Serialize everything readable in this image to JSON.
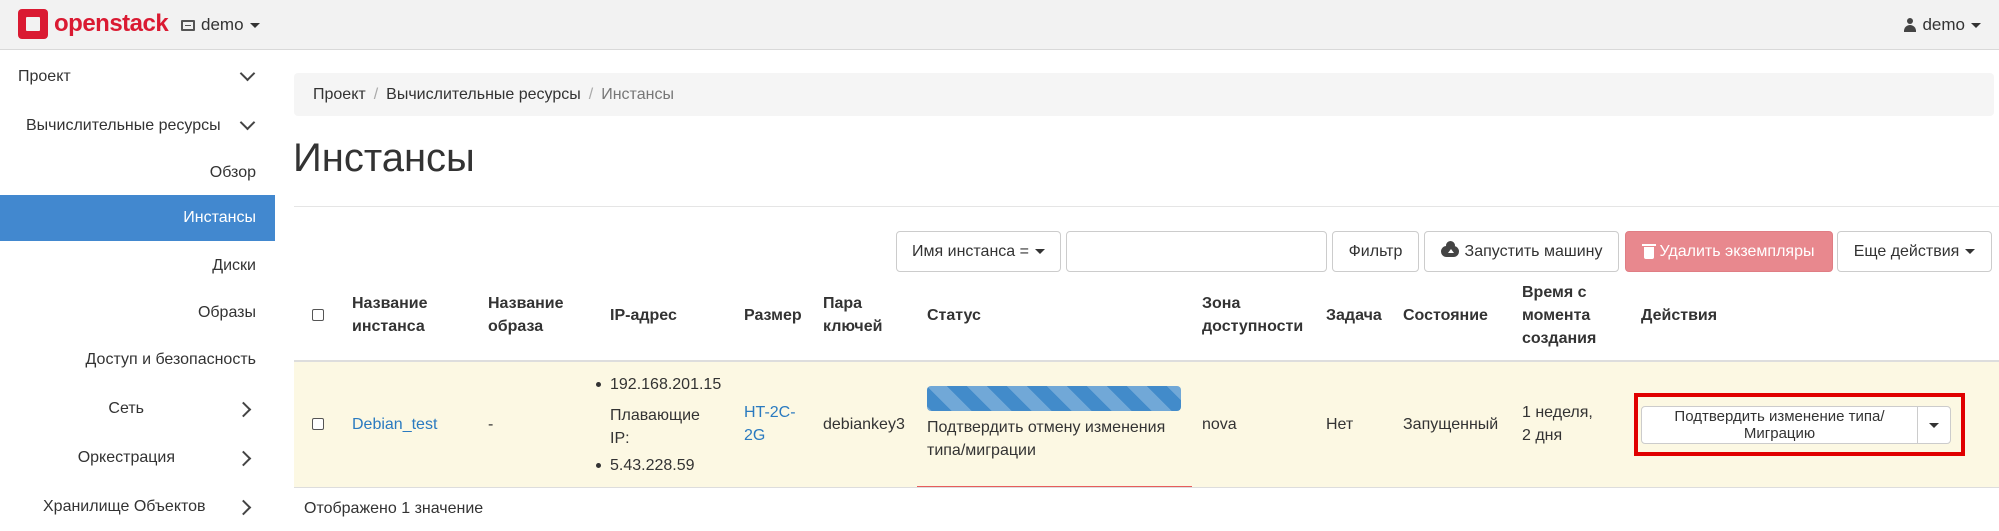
{
  "navbar": {
    "brand": "openstack",
    "project": "demo",
    "user": "demo"
  },
  "sidebar": {
    "items": [
      {
        "label": "Проект",
        "icon": "chevron-down-icon"
      },
      {
        "label": "Вычислительные ресурсы",
        "icon": "chevron-down-icon"
      },
      {
        "label": "Обзор"
      },
      {
        "label": "Инстансы",
        "active": true
      },
      {
        "label": "Диски"
      },
      {
        "label": "Образы"
      },
      {
        "label": "Доступ и безопасность"
      },
      {
        "label": "Сеть",
        "icon": "chevron-right-icon"
      },
      {
        "label": "Оркестрация",
        "icon": "chevron-right-icon"
      },
      {
        "label": "Хранилище Объектов",
        "icon": "chevron-right-icon"
      }
    ]
  },
  "breadcrumb": [
    "Проект",
    "Вычислительные ресурсы",
    "Инстансы"
  ],
  "page_title": "Инстансы",
  "toolbar": {
    "filter_select": "Имя инстанса =",
    "filter_input_value": "",
    "filter_button": "Фильтр",
    "launch_button": "Запустить машину",
    "delete_button": "Удалить экземпляры",
    "more_actions": "Еще действия"
  },
  "table": {
    "headers": {
      "name": [
        "Название",
        "инстанса"
      ],
      "image": [
        "Название",
        "образа"
      ],
      "ip": "IP-адрес",
      "size": "Размер",
      "keypair": [
        "Пара",
        "ключей"
      ],
      "status": "Статус",
      "zone": [
        "Зона",
        "доступности"
      ],
      "task": "Задача",
      "state": "Состояние",
      "time": [
        "Время с",
        "момента",
        "создания"
      ],
      "actions": "Действия"
    },
    "rows": [
      {
        "name": "Debian_test",
        "image": "-",
        "ip_fixed": "192.168.201.15",
        "floating_label": [
          "Плавающие",
          "IP:"
        ],
        "ip_floating": "5.43.228.59",
        "size": [
          "HT-2C-",
          "2G"
        ],
        "keypair": "debiankey3",
        "status": [
          "Подтвердить отмену изменения",
          "типа/миграции"
        ],
        "progress_percent": 100,
        "zone": "nova",
        "task": "Нет",
        "state": "Запущенный",
        "time": [
          "1 неделя,",
          "2 дня"
        ],
        "action": "Подтвердить изменение типа/Миграцию"
      }
    ]
  },
  "footer": "Отображено 1 значение",
  "colors": {
    "brand": "#da1a32",
    "active_nav": "#4288cf",
    "row_highlight": "#fcf8e3",
    "danger_button": "#e8888e",
    "link": "#2a7ac0",
    "annotation_box": "#e00000"
  }
}
